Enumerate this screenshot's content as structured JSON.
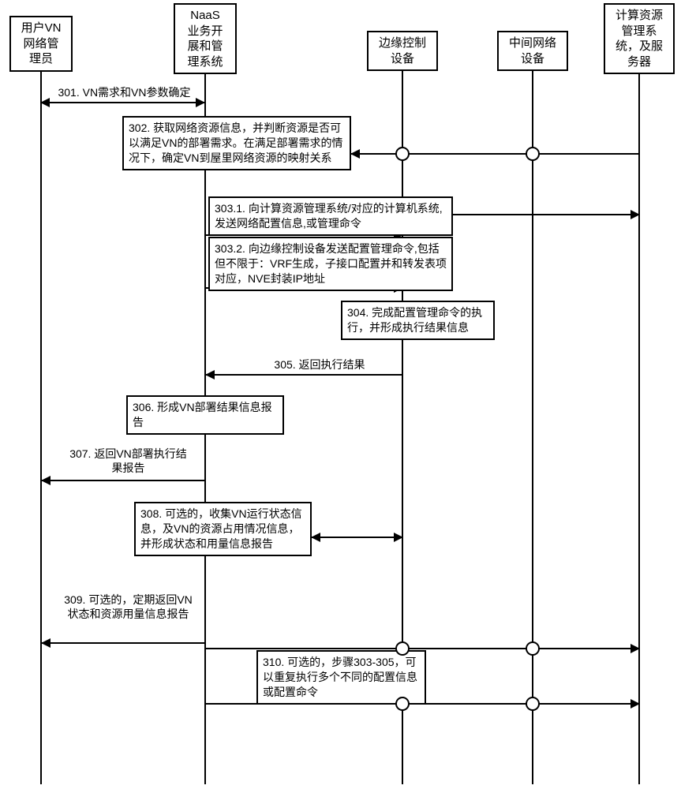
{
  "participants": {
    "user": "用户VN\n网络管\n理员",
    "naas": "NaaS\n业务开\n展和管\n理系统",
    "edge": "边缘控制\n设备",
    "middle": "中间网络\n设备",
    "compute": "计算资源\n管理系\n统，及服\n务器"
  },
  "steps": {
    "s301": "301.    VN需求和VN参数确定",
    "s302": "302.   获取网络资源信息，并判断资源是否可以满足VN的部署需求。在满足部署需求的情况下，确定VN到屋里网络资源的映射关系",
    "s3031": "303.1.  向计算资源管理系统/对应的计算机系统,发送网络配置信息,或管理命令",
    "s3032": "303.2.  向边缘控制设备发送配置管理命令,包括但不限于：VRF生成，子接口配置并和转发表项对应，NVE封装IP地址",
    "s304": "304.  完成配置管理命令的执行，并形成执行结果信息",
    "s305": "305. 返回执行结果",
    "s306": "306.  形成VN部署结果信息报告",
    "s307": "307.  返回VN部署执行结果报告",
    "s308": "308.  可选的，收集VN运行状态信息，及VN的资源占用情况信息，并形成状态和用量信息报告",
    "s309": "309.  可选的，定期返回VN状态和资源用量信息报告",
    "s310": "310.  可选的，步骤303-305，可以重复执行多个不同的配置信息或配置命令"
  }
}
